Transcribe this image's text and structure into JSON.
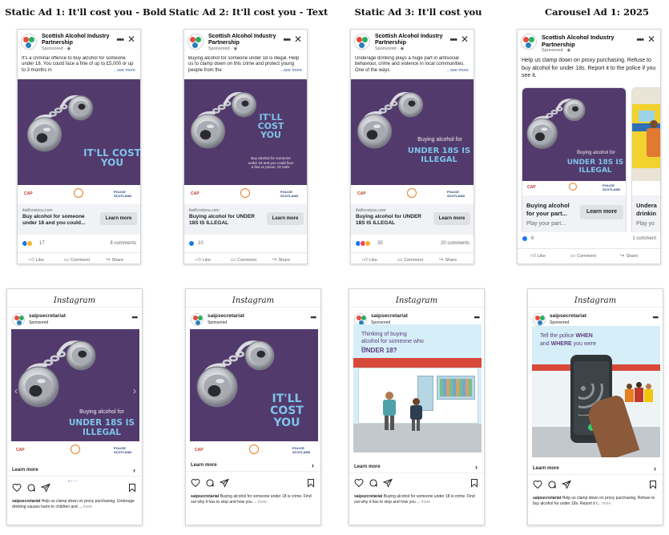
{
  "columns": [
    {
      "title": "Static Ad 1: It'll cost you - Bold"
    },
    {
      "title": "Static Ad 2: It'll cost you - Text"
    },
    {
      "title": "Static Ad 3: It'll cost you"
    },
    {
      "title": "Carousel Ad 1: 2025"
    }
  ],
  "facebook_ads": [
    {
      "page_name": "Scottish Alcohol Industry Partnership",
      "sponsored": "Sponsored · ",
      "body": "It's a criminal offence to buy alcohol for someone under 18. You could face a fine of up to £5,000 or up to 3 months in",
      "see_more": "...see more",
      "art_heading": "IT'LL COST YOU",
      "domain": "itwillcostyou.com",
      "headline": "Buy alcohol for someone under 18 and you could...",
      "cta": "Learn more",
      "reaction_count": "17",
      "comments": "8 comments",
      "actions": {
        "like": "Like",
        "comment": "Comment",
        "share": "Share"
      }
    },
    {
      "page_name": "Scottish Alcohol Industry Partnership",
      "sponsored": "Sponsored · ",
      "body": "Buying alcohol for someone under 18 is illegal. Help us to clamp down on this crime and protect young people from the",
      "see_more": "...see more",
      "art_heading": "IT'LL COST YOU",
      "art_small": "Buy alcohol for someone under 18 and you could face a fine or prison. Or both.",
      "domain": "itwillcostyou.com",
      "headline": "Buying alcohol for UNDER 18S IS ILLEGAL",
      "cta": "Learn more",
      "reaction_count": "10",
      "comments": "",
      "actions": {
        "like": "Like",
        "comment": "Comment",
        "share": "Share"
      }
    },
    {
      "page_name": "Scottish Alcohol Industry Partnership",
      "sponsored": "Sponsored · ",
      "body": "Underage drinking plays a huge part in antisocial behaviour, crime and violence in local communities. One of the ways",
      "see_more": "...see more",
      "art_sub": "Buying alcohol for",
      "art_heading": "UNDER 18S IS ILLEGAL",
      "domain": "itwillcostyou.com",
      "headline": "Buying alcohol for UNDER 18S IS ILLEGAL",
      "cta": "Learn more",
      "reaction_count": "35",
      "comments": "20 comments",
      "actions": {
        "like": "Like",
        "comment": "Comment",
        "share": "Share"
      }
    },
    {
      "page_name": "Scottish Alcohol Industry Partnership",
      "sponsored": "Sponsored · ",
      "body": "Help us clamp down on proxy purchasing. Refuse to buy alcohol for under 18s. Report it to the police if you see it.",
      "art_sub": "Buying alcohol for",
      "art_heading": "UNDER 18S IS ILLEGAL",
      "headline": "Buying alcohol for your part...",
      "headline2": "Undera drinkin",
      "play": "Play your part...",
      "play2": "Play yo",
      "cta": "Learn more",
      "reaction_count": "6",
      "comments": "1 comment",
      "actions": {
        "like": "Like",
        "comment": "Comment",
        "share": "Share"
      }
    }
  ],
  "instagram_ads": [
    {
      "app": "Instagram",
      "user": "saipsecretariat",
      "sponsored": "Sponsored",
      "art_sub": "Buying alcohol for",
      "art_heading": "UNDER 18S IS ILLEGAL",
      "learn_more": "Learn more",
      "caption_user": "saipsecretariat",
      "caption": "Help us clamp down on proxy purchasing. Underage drinking causes harm to children and ...",
      "more": "more"
    },
    {
      "app": "Instagram",
      "user": "saipsecretariat",
      "sponsored": "Sponsored",
      "art_heading": "IT'LL COST YOU",
      "learn_more": "Learn more",
      "caption_user": "saipsecretariat",
      "caption": "Buying alcohol for someone under 18 is crime. Find out why it has to stop and how you ...",
      "more": "more"
    },
    {
      "app": "Instagram",
      "user": "saipsecretariat",
      "sponsored": "Sponsored",
      "art_text": "Thinking of buying alcohol for someone who is",
      "art_highlight": "UNDER 18?",
      "learn_more": "Learn more",
      "caption_user": "saipsecretariat",
      "caption": "Buying alcohol for someone under 18 is crime. Find out why it has to stop and how you ...",
      "more": "more"
    },
    {
      "app": "Instagram",
      "user": "saipsecretariat",
      "sponsored": "Sponsored",
      "art_text_a": "Tell the police",
      "art_when": "WHEN",
      "art_text_b": "and",
      "art_where": "WHERE",
      "art_text_c": "you were",
      "learn_more": "Learn more",
      "caption_user": "saipsecretariat",
      "caption": "Help us clamp down on proxy purchasing. Refuse to buy alcohol for under 18s. Report it t...",
      "more": "more"
    }
  ],
  "logos": {
    "cap": "CAP",
    "police": "POLICE SCOTLAND"
  },
  "colors": {
    "purple": "#533a6d",
    "headline_blue": "#7dc4e8",
    "fb_link": "#385898"
  }
}
